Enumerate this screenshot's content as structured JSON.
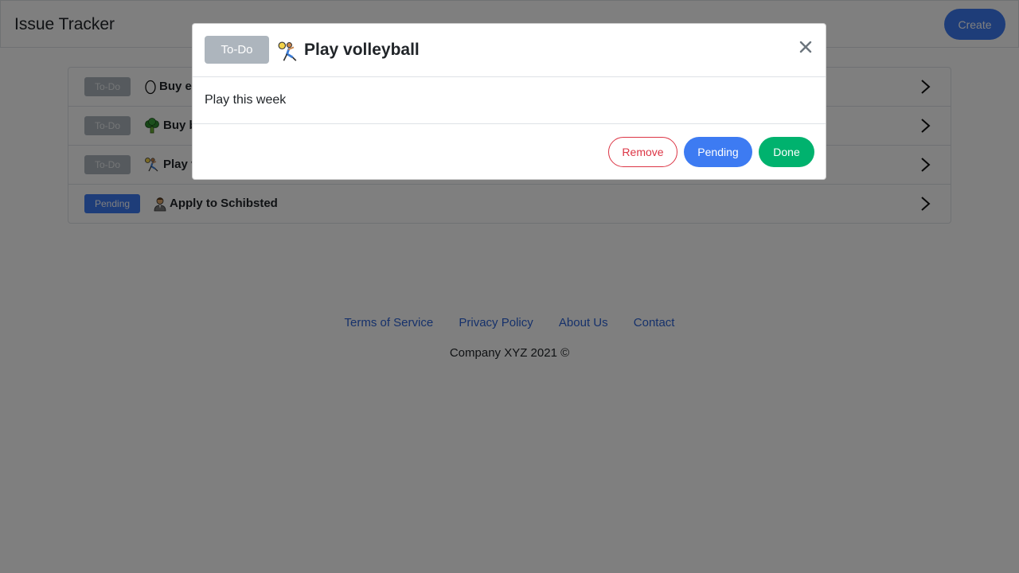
{
  "app": {
    "title": "Issue Tracker",
    "create_label": "Create"
  },
  "issues": [
    {
      "status": "To-Do",
      "icon": "egg-icon",
      "title": "Buy eggs"
    },
    {
      "status": "To-Do",
      "icon": "broccoli-icon",
      "title": "Buy broccoli"
    },
    {
      "status": "To-Do",
      "icon": "volleyball-player-icon",
      "title": "Play volleyball"
    },
    {
      "status": "Pending",
      "icon": "office-worker-icon",
      "title": "Apply to Schibsted"
    }
  ],
  "footer": {
    "links": [
      "Terms of Service",
      "Privacy Policy",
      "About Us",
      "Contact"
    ],
    "copyright": "Company XYZ 2021 ©"
  },
  "modal": {
    "status": "To-Do",
    "icon": "volleyball-player-icon",
    "title": "Play volleyball",
    "description": "Play this week",
    "close_label": "×",
    "remove_label": "Remove",
    "pending_label": "Pending",
    "done_label": "Done"
  },
  "colors": {
    "primary": "#3d7bf2",
    "success": "#00b26e",
    "danger": "#dc3545",
    "todo_badge": "#adb5bd",
    "link": "#2c63d6"
  }
}
